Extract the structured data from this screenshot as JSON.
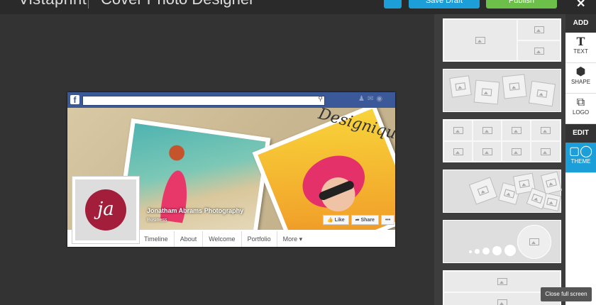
{
  "app": {
    "brand": "Vistaprint",
    "title": "Cover Photo Designer",
    "save_label": "Save Draft",
    "publish_label": "Publish",
    "close_glyph": "✕"
  },
  "facebook": {
    "logo_glyph": "f",
    "cover_text": "Designique",
    "profile_initials": "ja",
    "page_name": "Jonatham Abrams Photography",
    "page_category": "Business",
    "like_label": "Like",
    "share_label": "Share",
    "more_dots": "•••",
    "nav": [
      "Timeline",
      "About",
      "Welcome",
      "Portfolio",
      "More ▾"
    ]
  },
  "tools": {
    "add_header": "ADD",
    "edit_header": "EDIT",
    "text_label": "TEXT",
    "shape_label": "SHAPE",
    "logo_label": "LOGO",
    "theme_label": "THEME"
  },
  "tooltip": "Close full screen",
  "colors": {
    "accent": "#1c9fd8",
    "publish": "#6cc04a",
    "facebook_blue": "#3b5998",
    "logo_red": "#a31e3a"
  },
  "icons": {
    "search": "search-icon",
    "text": "text-icon",
    "shape": "cube-icon",
    "logo": "logo-icon",
    "theme": "theme-icon",
    "image_placeholder": "image-placeholder-icon"
  }
}
